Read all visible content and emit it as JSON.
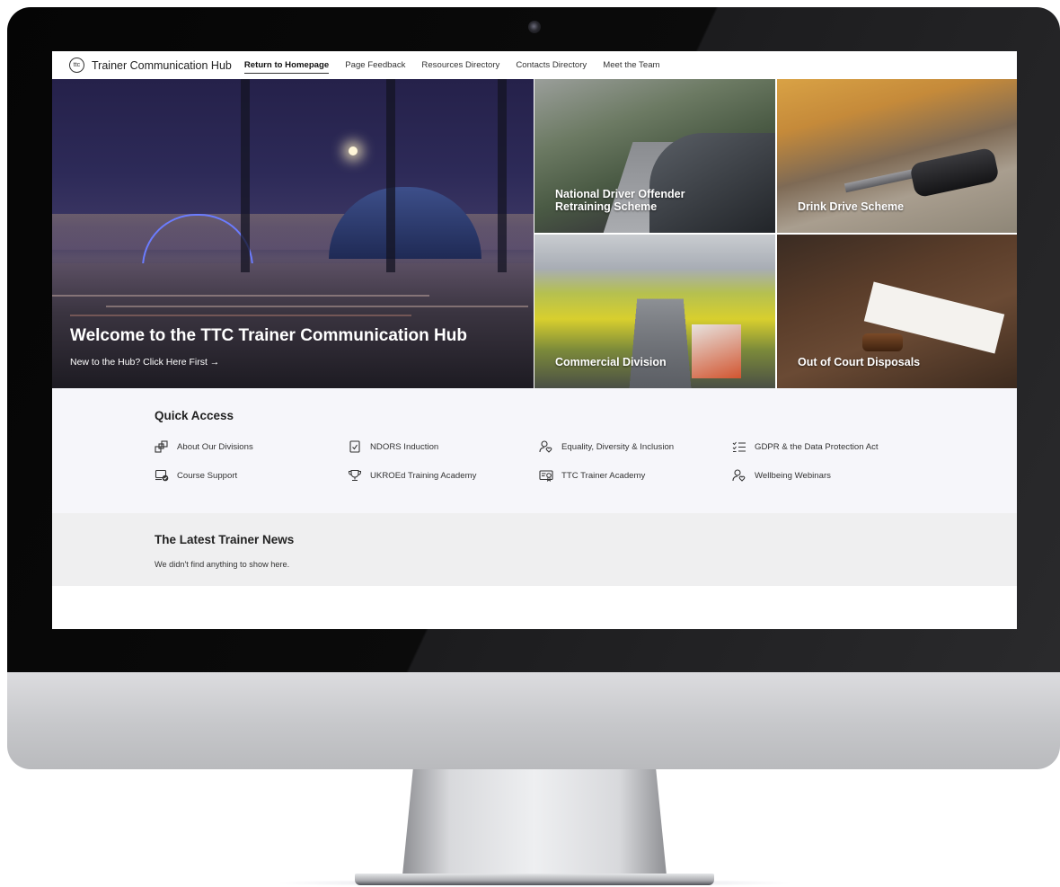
{
  "header": {
    "logo_text": "ttc",
    "site_title": "Trainer Communication Hub",
    "nav": [
      {
        "label": "Return to Homepage",
        "active": true
      },
      {
        "label": "Page Feedback",
        "active": false
      },
      {
        "label": "Resources Directory",
        "active": false
      },
      {
        "label": "Contacts Directory",
        "active": false
      },
      {
        "label": "Meet the Team",
        "active": false
      }
    ]
  },
  "hero": {
    "title": "Welcome to the TTC Trainer Communication Hub",
    "cta": "New to the Hub? Click Here First →"
  },
  "tiles": [
    {
      "label": "National Driver Offender Retraining Scheme"
    },
    {
      "label": "Drink Drive Scheme"
    },
    {
      "label": "Commercial Division"
    },
    {
      "label": "Out of Court Disposals"
    }
  ],
  "quick_access": {
    "title": "Quick Access",
    "items": [
      {
        "label": "About Our Divisions",
        "icon": "org-chart-icon"
      },
      {
        "label": "NDORS Induction",
        "icon": "clipboard-check-icon"
      },
      {
        "label": "Equality, Diversity & Inclusion",
        "icon": "person-heart-icon"
      },
      {
        "label": "GDPR & the Data Protection Act",
        "icon": "checklist-icon"
      },
      {
        "label": "Course Support",
        "icon": "laptop-check-icon"
      },
      {
        "label": "UKROEd Training Academy",
        "icon": "trophy-icon"
      },
      {
        "label": "TTC Trainer Academy",
        "icon": "certificate-icon"
      },
      {
        "label": "Wellbeing Webinars",
        "icon": "person-heart-icon"
      }
    ]
  },
  "news": {
    "title": "The Latest Trainer News",
    "empty_message": "We didn't find anything to show here."
  }
}
